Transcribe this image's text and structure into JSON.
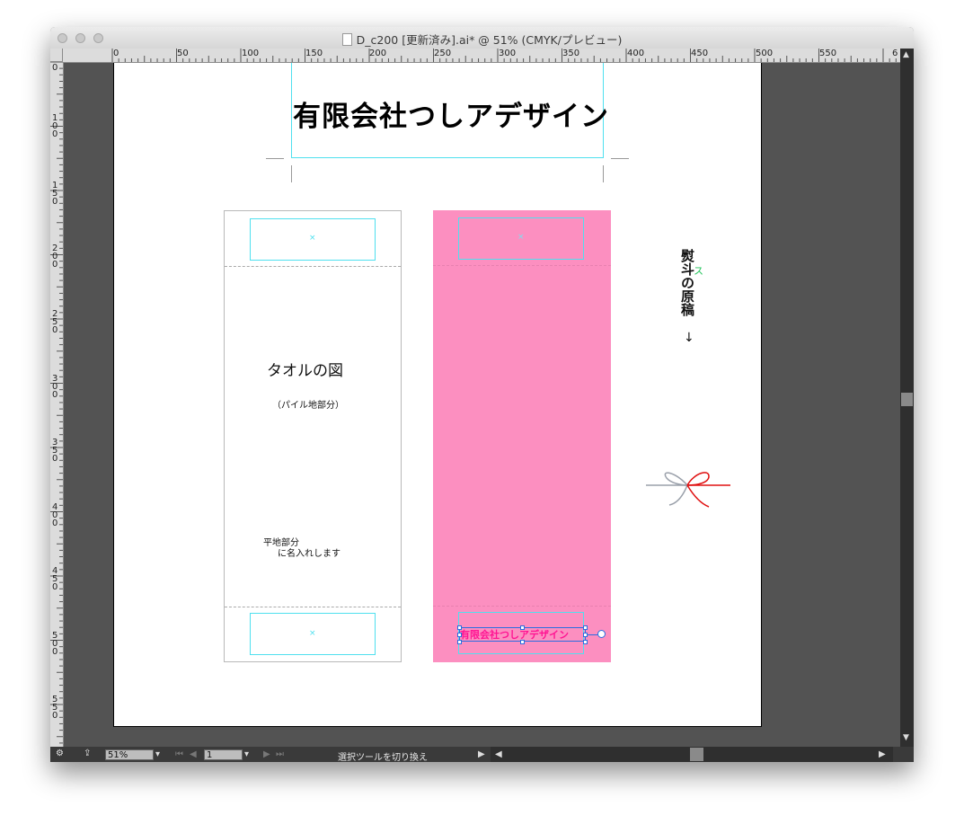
{
  "window": {
    "title": "D_c200 [更新済み].ai* @ 51% (CMYK/プレビュー)"
  },
  "ruler": {
    "top_labels": [
      "0",
      "50",
      "100",
      "150",
      "200",
      "250",
      "300",
      "350",
      "400",
      "450",
      "500",
      "550",
      "6"
    ],
    "left_labels": [
      "0",
      "100",
      "150",
      "200",
      "250",
      "300",
      "350",
      "400",
      "450",
      "500",
      "550"
    ]
  },
  "artboard": {
    "company_name": "有限会社つしアデザイン",
    "towel_left": {
      "title": "タオルの図",
      "subtitle": "（パイル地部分）",
      "note_line1": "平地部分",
      "note_line2": "に名入れします",
      "x_marks": [
        "×",
        "×"
      ]
    },
    "towel_right": {
      "background_color": "#fc8fc0",
      "company_name": "有限会社つしアデザイン",
      "x_mark": "×"
    },
    "noshi_label": "熨斗の原稿",
    "noshi_label_overlay": "ス",
    "noshi_arrow": "↓"
  },
  "statusbar": {
    "zoom": "51%",
    "page": "1",
    "tool_hint": "選択ツールを切り換え"
  },
  "colors": {
    "guide_cyan": "#4fe0ef",
    "pink_fill": "#fc8fc0",
    "pink_text": "#ff1493",
    "ribbon_red": "#e01010",
    "ribbon_gray": "#9aa0aa"
  }
}
